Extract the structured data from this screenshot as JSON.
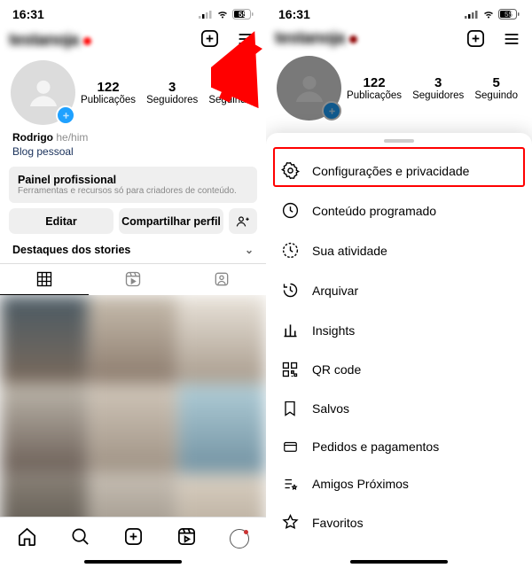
{
  "statusbar": {
    "time": "16:31",
    "battery": "55"
  },
  "profile": {
    "username": "testanoja",
    "stats": {
      "posts_n": "122",
      "posts_l": "Publicações",
      "followers_n": "3",
      "followers_l": "Seguidores",
      "following_n": "5",
      "following_l": "Seguindo"
    },
    "name": "Rodrigo",
    "pronouns": "he/him",
    "category": "",
    "link": "Blog pessoal",
    "pro_title": "Painel profissional",
    "pro_sub": "Ferramentas e recursos só para criadores de conteúdo.",
    "edit_btn": "Editar",
    "share_btn": "Compartilhar perfil",
    "highlights_label": "Destaques dos stories"
  },
  "menu": {
    "items": [
      {
        "label": "Configurações e privacidade"
      },
      {
        "label": "Conteúdo programado"
      },
      {
        "label": "Sua atividade"
      },
      {
        "label": "Arquivar"
      },
      {
        "label": "Insights"
      },
      {
        "label": "QR code"
      },
      {
        "label": "Salvos"
      },
      {
        "label": "Pedidos e pagamentos"
      },
      {
        "label": "Amigos Próximos"
      },
      {
        "label": "Favoritos"
      }
    ]
  }
}
